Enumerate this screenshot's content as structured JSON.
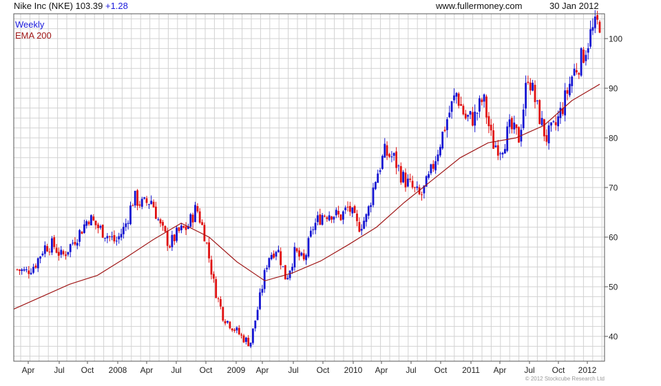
{
  "header": {
    "symbol_label": "Nike Inc (NKE)",
    "price": "103.39",
    "change": "+1.28",
    "source": "www.fullermoney.com",
    "date": "30 Jan 2012"
  },
  "copyright": "© 2012 Stockcube Research Ltd",
  "colors": {
    "up": "#1414d2",
    "down": "#e01010",
    "ema": "#a01818",
    "grid": "#d2d2d2",
    "frame": "#555555",
    "legend_weekly": "#1a1adb",
    "legend_ema": "#a01818"
  },
  "chart_data": {
    "type": "candlestick",
    "interval": "Weekly",
    "legend": [
      {
        "name": "Weekly",
        "color": "#1a1adb"
      },
      {
        "name": "EMA 200",
        "color": "#a01818"
      }
    ],
    "ylim": [
      35,
      105
    ],
    "y_ticks": [
      40,
      50,
      60,
      70,
      80,
      90,
      100
    ],
    "x_ticks": [
      "Apr",
      "Jul",
      "Oct",
      "2008",
      "Apr",
      "Jul",
      "Oct",
      "2009",
      "Apr",
      "Jul",
      "Oct",
      "2010",
      "Apr",
      "Jul",
      "Oct",
      "2011",
      "Apr",
      "Jul",
      "Oct",
      "2012"
    ],
    "grid": true,
    "ema_200": [
      45.5,
      48,
      50.5,
      52.3,
      55.8,
      59.5,
      62.8,
      60,
      55,
      51.2,
      52.8,
      55.2,
      58.5,
      62,
      67,
      71.5,
      76,
      79,
      80,
      82.5,
      87.5,
      90.8
    ],
    "series": {
      "name": "Weekly",
      "close_anchors": [
        53.5,
        53,
        54.5,
        58,
        58.5,
        56,
        58.5,
        61,
        64,
        62,
        60.5,
        59,
        62,
        68,
        66.5,
        67.5,
        62,
        58.5,
        61,
        62,
        66,
        60,
        50,
        44,
        42,
        40,
        38.5,
        47,
        56,
        58,
        51.5,
        57,
        55,
        62,
        64.5,
        65,
        64,
        66,
        62,
        64,
        72,
        77,
        76,
        72,
        70,
        68,
        72,
        78,
        84,
        89,
        84,
        84,
        88,
        79,
        78,
        82,
        80,
        93,
        86,
        80,
        82,
        87,
        93,
        96,
        101,
        103.39
      ]
    }
  }
}
